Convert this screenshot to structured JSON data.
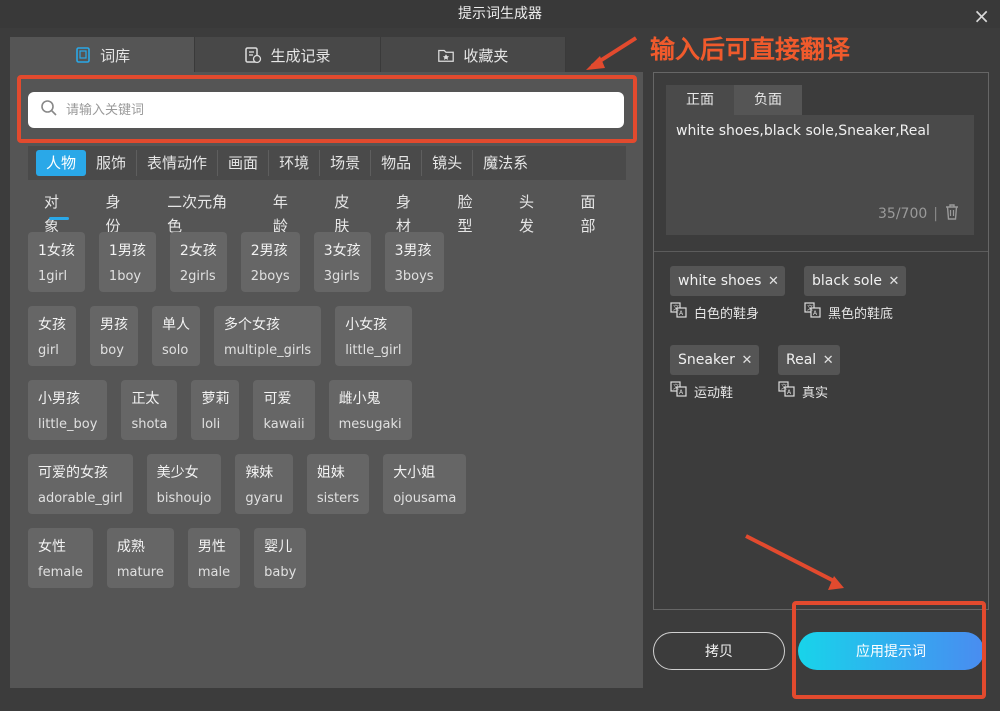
{
  "window": {
    "title": "提示词生成器"
  },
  "tabs": [
    {
      "label": "词库",
      "icon": "book-icon"
    },
    {
      "label": "生成记录",
      "icon": "history-icon"
    },
    {
      "label": "收藏夹",
      "icon": "favorites-icon"
    }
  ],
  "search": {
    "placeholder": "请输入关键词"
  },
  "categories": [
    "人物",
    "服饰",
    "表情动作",
    "画面",
    "环境",
    "场景",
    "物品",
    "镜头",
    "魔法系"
  ],
  "subcategories": [
    "对象",
    "身份",
    "二次元角色",
    "年龄",
    "皮肤",
    "身材",
    "脸型",
    "头发",
    "面部"
  ],
  "chips": [
    [
      {
        "cn": "1女孩",
        "en": "1girl"
      },
      {
        "cn": "1男孩",
        "en": "1boy"
      },
      {
        "cn": "2女孩",
        "en": "2girls"
      },
      {
        "cn": "2男孩",
        "en": "2boys"
      },
      {
        "cn": "3女孩",
        "en": "3girls"
      },
      {
        "cn": "3男孩",
        "en": "3boys"
      }
    ],
    [
      {
        "cn": "女孩",
        "en": "girl"
      },
      {
        "cn": "男孩",
        "en": "boy"
      },
      {
        "cn": "单人",
        "en": "solo"
      },
      {
        "cn": "多个女孩",
        "en": "multiple_girls"
      },
      {
        "cn": "小女孩",
        "en": "little_girl"
      }
    ],
    [
      {
        "cn": "小男孩",
        "en": "little_boy"
      },
      {
        "cn": "正太",
        "en": "shota"
      },
      {
        "cn": "萝莉",
        "en": "loli"
      },
      {
        "cn": "可爱",
        "en": "kawaii"
      },
      {
        "cn": "雌小鬼",
        "en": "mesugaki"
      }
    ],
    [
      {
        "cn": "可爱的女孩",
        "en": "adorable_girl"
      },
      {
        "cn": "美少女",
        "en": "bishoujo"
      },
      {
        "cn": "辣妹",
        "en": "gyaru"
      },
      {
        "cn": "姐妹",
        "en": "sisters"
      },
      {
        "cn": "大小姐",
        "en": "ojousama"
      }
    ],
    [
      {
        "cn": "女性",
        "en": "female"
      },
      {
        "cn": "成熟",
        "en": "mature"
      },
      {
        "cn": "男性",
        "en": "male"
      },
      {
        "cn": "婴儿",
        "en": "baby"
      }
    ]
  ],
  "prompt": {
    "tabs": [
      "正面",
      "负面"
    ],
    "text": "white shoes,black sole,Sneaker,Real",
    "count": "35/700"
  },
  "tags": [
    {
      "en": "white shoes",
      "cn": "白色的鞋身"
    },
    {
      "en": "black sole",
      "cn": "黑色的鞋底"
    },
    {
      "en": "Sneaker",
      "cn": "运动鞋"
    },
    {
      "en": "Real",
      "cn": "真实"
    }
  ],
  "buttons": {
    "copy": "拷贝",
    "apply": "应用提示词"
  },
  "annotation": {
    "text": "输入后可直接翻译",
    "color": "#e24a2e"
  },
  "colors": {
    "accent": "#2aa8e8",
    "annotation": "#f05a2c"
  }
}
